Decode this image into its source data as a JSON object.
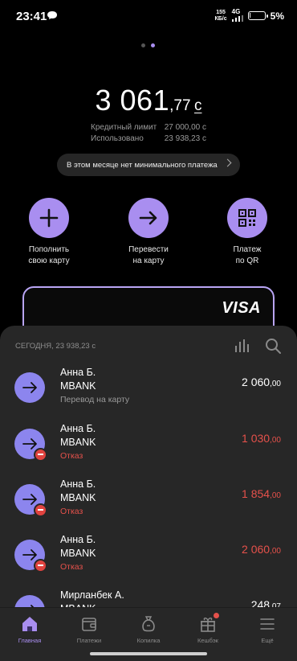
{
  "status_bar": {
    "time": "23:41",
    "net_speed_value": "155",
    "net_speed_unit": "КБ/с",
    "network": "4G",
    "battery": "5%"
  },
  "balance": {
    "main": "3 061",
    "fraction": ",77",
    "currency": "с"
  },
  "limits": [
    {
      "label": "Кредитный лимит",
      "value": "27 000,00 с"
    },
    {
      "label": "Использовано",
      "value": "23 938,23 с"
    }
  ],
  "min_payment_banner": "В этом месяце нет минимального платежа",
  "actions": [
    {
      "label": "Пополнить\nсвою карту",
      "icon": "plus-icon"
    },
    {
      "label": "Перевести\nна карту",
      "icon": "arrow-right-icon"
    },
    {
      "label": "Платеж\nпо QR",
      "icon": "qr-icon"
    }
  ],
  "card": {
    "brand": "VISA"
  },
  "transactions": {
    "header": "СЕГОДНЯ, 23 938,23 с",
    "items": [
      {
        "name": "Анна Б.",
        "bank": "MBANK",
        "status": "Перевод на карту",
        "amount_int": "2 060",
        "amount_frac": ",00",
        "failed": false
      },
      {
        "name": "Анна Б.",
        "bank": "MBANK",
        "status": "Отказ",
        "amount_int": "1 030",
        "amount_frac": ",00",
        "failed": true
      },
      {
        "name": "Анна Б.",
        "bank": "MBANK",
        "status": "Отказ",
        "amount_int": "1 854",
        "amount_frac": ",00",
        "failed": true
      },
      {
        "name": "Анна Б.",
        "bank": "MBANK",
        "status": "Отказ",
        "amount_int": "2 060",
        "amount_frac": ",00",
        "failed": true
      },
      {
        "name": "Мирланбек А.",
        "bank": "MBANK",
        "status": "",
        "amount_int": "248",
        "amount_frac": ",07",
        "failed": false
      }
    ]
  },
  "nav": [
    {
      "label": "Главная",
      "icon": "home-icon",
      "active": true
    },
    {
      "label": "Платежи",
      "icon": "wallet-icon",
      "active": false
    },
    {
      "label": "Копилка",
      "icon": "piggy-bank-icon",
      "active": false
    },
    {
      "label": "Кешбэк",
      "icon": "gift-icon",
      "active": false
    },
    {
      "label": "Ещё",
      "icon": "menu-icon",
      "active": false
    }
  ],
  "colors": {
    "accent": "#a98ef0",
    "avatar": "#8c85ee",
    "danger": "#e5514b",
    "sheet": "#272727"
  }
}
